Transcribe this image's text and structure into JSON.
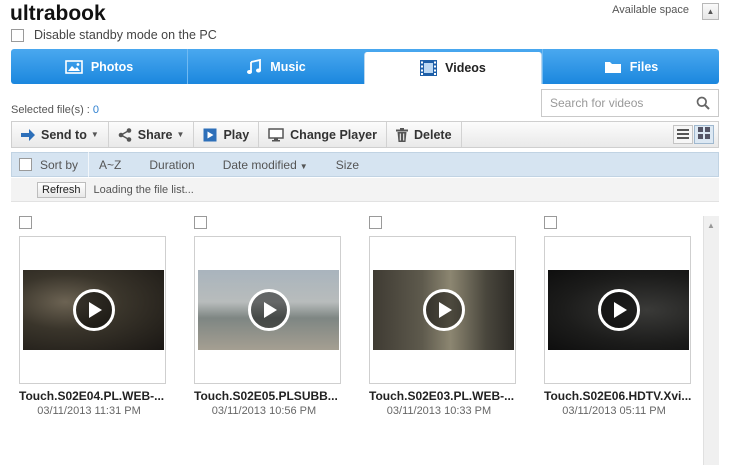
{
  "header": {
    "device_name": "ultrabook",
    "standby_label": "Disable standby mode on the PC",
    "available_space_label": "Available space"
  },
  "tabs": [
    {
      "label": "Photos",
      "icon": "photo-icon"
    },
    {
      "label": "Music",
      "icon": "music-note-icon"
    },
    {
      "label": "Videos",
      "icon": "film-icon",
      "active": true
    },
    {
      "label": "Files",
      "icon": "folder-icon"
    }
  ],
  "selection": {
    "label": "Selected file(s) :",
    "count": "0"
  },
  "search": {
    "placeholder": "Search for videos"
  },
  "toolbar": {
    "send_to": "Send to",
    "share": "Share",
    "play": "Play",
    "change_player": "Change Player",
    "delete": "Delete"
  },
  "sortbar": {
    "sort_by": "Sort by",
    "options": [
      "A~Z",
      "Duration",
      "Date modified",
      "Size"
    ]
  },
  "status": {
    "refresh_label": "Refresh",
    "loading_text": "Loading the file list..."
  },
  "videos": [
    {
      "name": "Touch.S02E04.PL.WEB-...",
      "date": "03/11/2013 11:31 PM"
    },
    {
      "name": "Touch.S02E05.PLSUBB...",
      "date": "03/11/2013 10:56 PM"
    },
    {
      "name": "Touch.S02E03.PL.WEB-...",
      "date": "03/11/2013 10:33 PM"
    },
    {
      "name": "Touch.S02E06.HDTV.Xvi...",
      "date": "03/11/2013 05:11 PM"
    }
  ],
  "colors": {
    "tab_blue": "#1b87de",
    "sortbar_blue": "#d6e4f1",
    "link_blue": "#2d7fd0"
  }
}
